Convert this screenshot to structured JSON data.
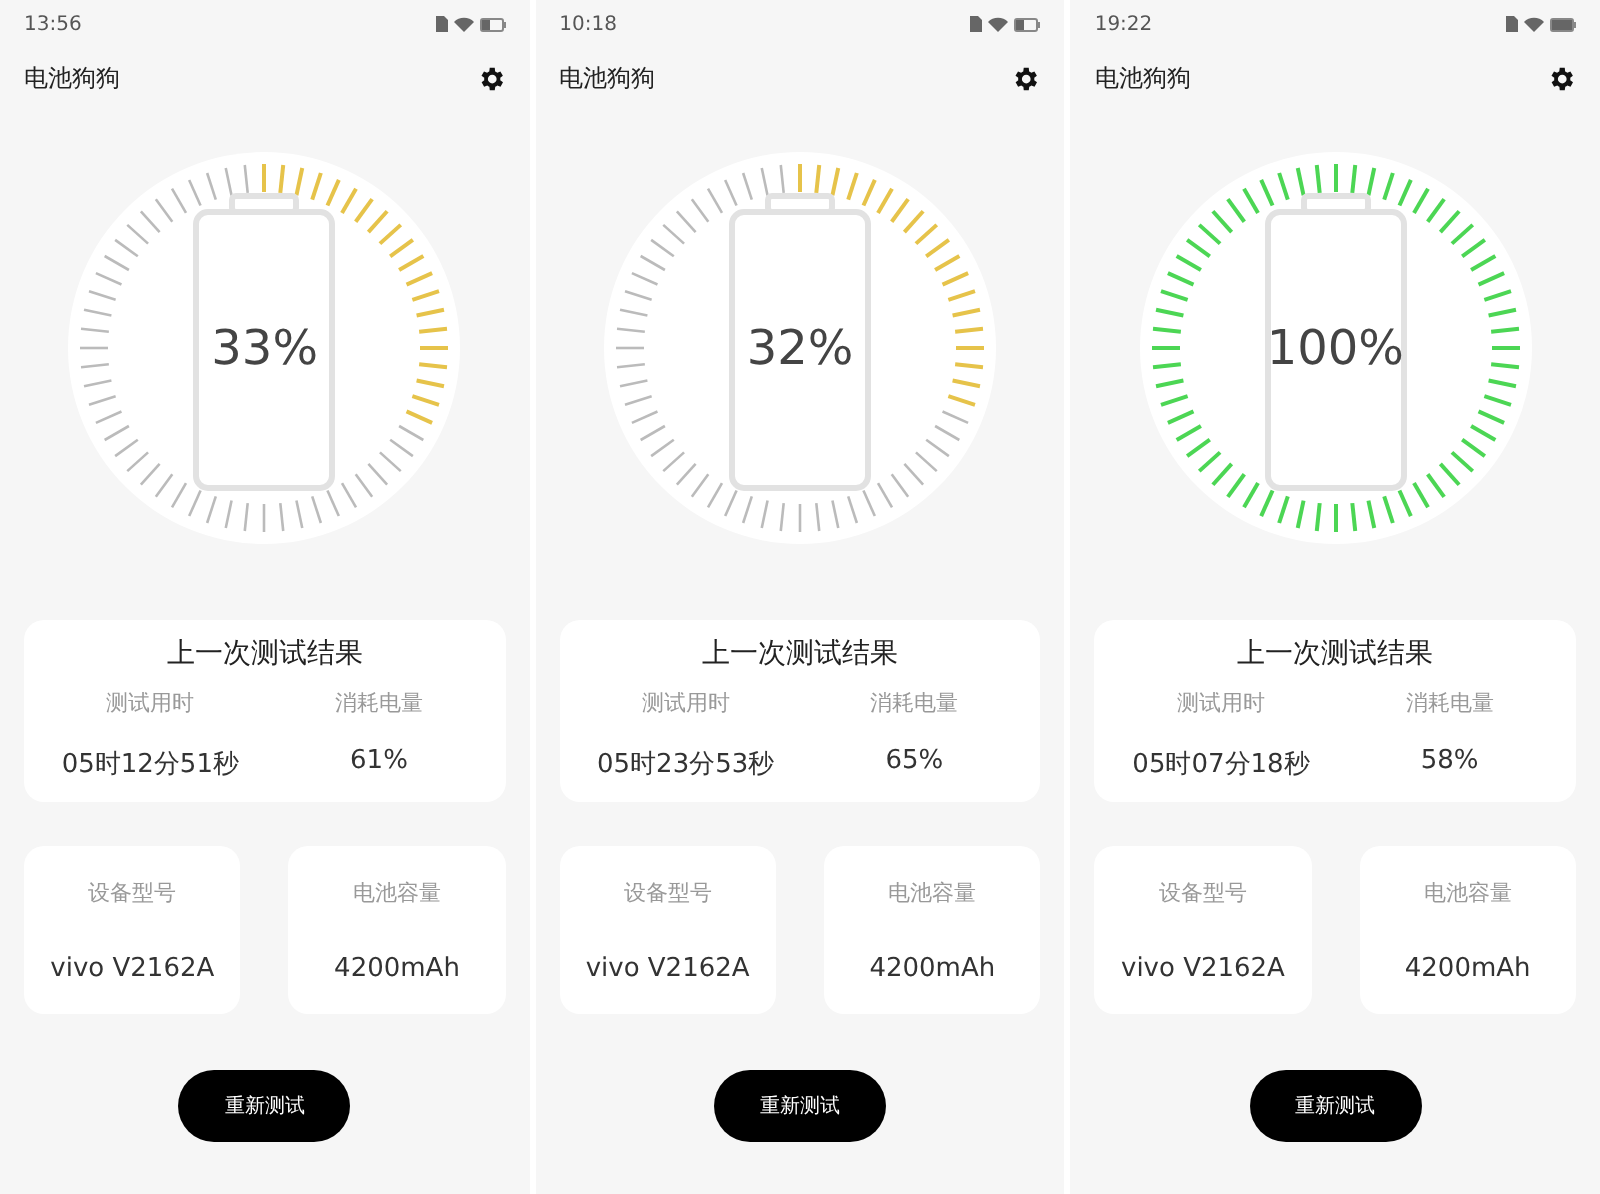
{
  "phones": [
    {
      "status_bar": {
        "time": "13:56"
      },
      "app_title": "电池狗狗",
      "gauge": {
        "percent": "33%",
        "color": "#e6c34a"
      },
      "last_result": {
        "title": "上一次测试结果",
        "columns": [
          {
            "label": "测试用时",
            "value": "05时12分51秒"
          },
          {
            "label": "消耗电量",
            "value": "61%"
          }
        ]
      },
      "info_cards": [
        {
          "label": "设备型号",
          "value": "vivo  V2162A"
        },
        {
          "label": "电池容量",
          "value": "4200mAh"
        }
      ],
      "button": "重新测试"
    },
    {
      "status_bar": {
        "time": "10:18"
      },
      "app_title": "电池狗狗",
      "gauge": {
        "percent": "32%",
        "color": "#e6c34a"
      },
      "last_result": {
        "title": "上一次测试结果",
        "columns": [
          {
            "label": "测试用时",
            "value": "05时23分53秒"
          },
          {
            "label": "消耗电量",
            "value": "65%"
          }
        ]
      },
      "info_cards": [
        {
          "label": "设备型号",
          "value": "vivo  V2162A"
        },
        {
          "label": "电池容量",
          "value": "4200mAh"
        }
      ],
      "button": "重新测试"
    },
    {
      "status_bar": {
        "time": "19:22"
      },
      "app_title": "电池狗狗",
      "gauge": {
        "percent": "100%",
        "color": "#4cd654"
      },
      "last_result": {
        "title": "上一次测试结果",
        "columns": [
          {
            "label": "测试用时",
            "value": "05时07分18秒"
          },
          {
            "label": "消耗电量",
            "value": "58%"
          }
        ]
      },
      "info_cards": [
        {
          "label": "设备型号",
          "value": "vivo  V2162A"
        },
        {
          "label": "电池容量",
          "value": "4200mAh"
        }
      ],
      "button": "重新测试"
    }
  ]
}
